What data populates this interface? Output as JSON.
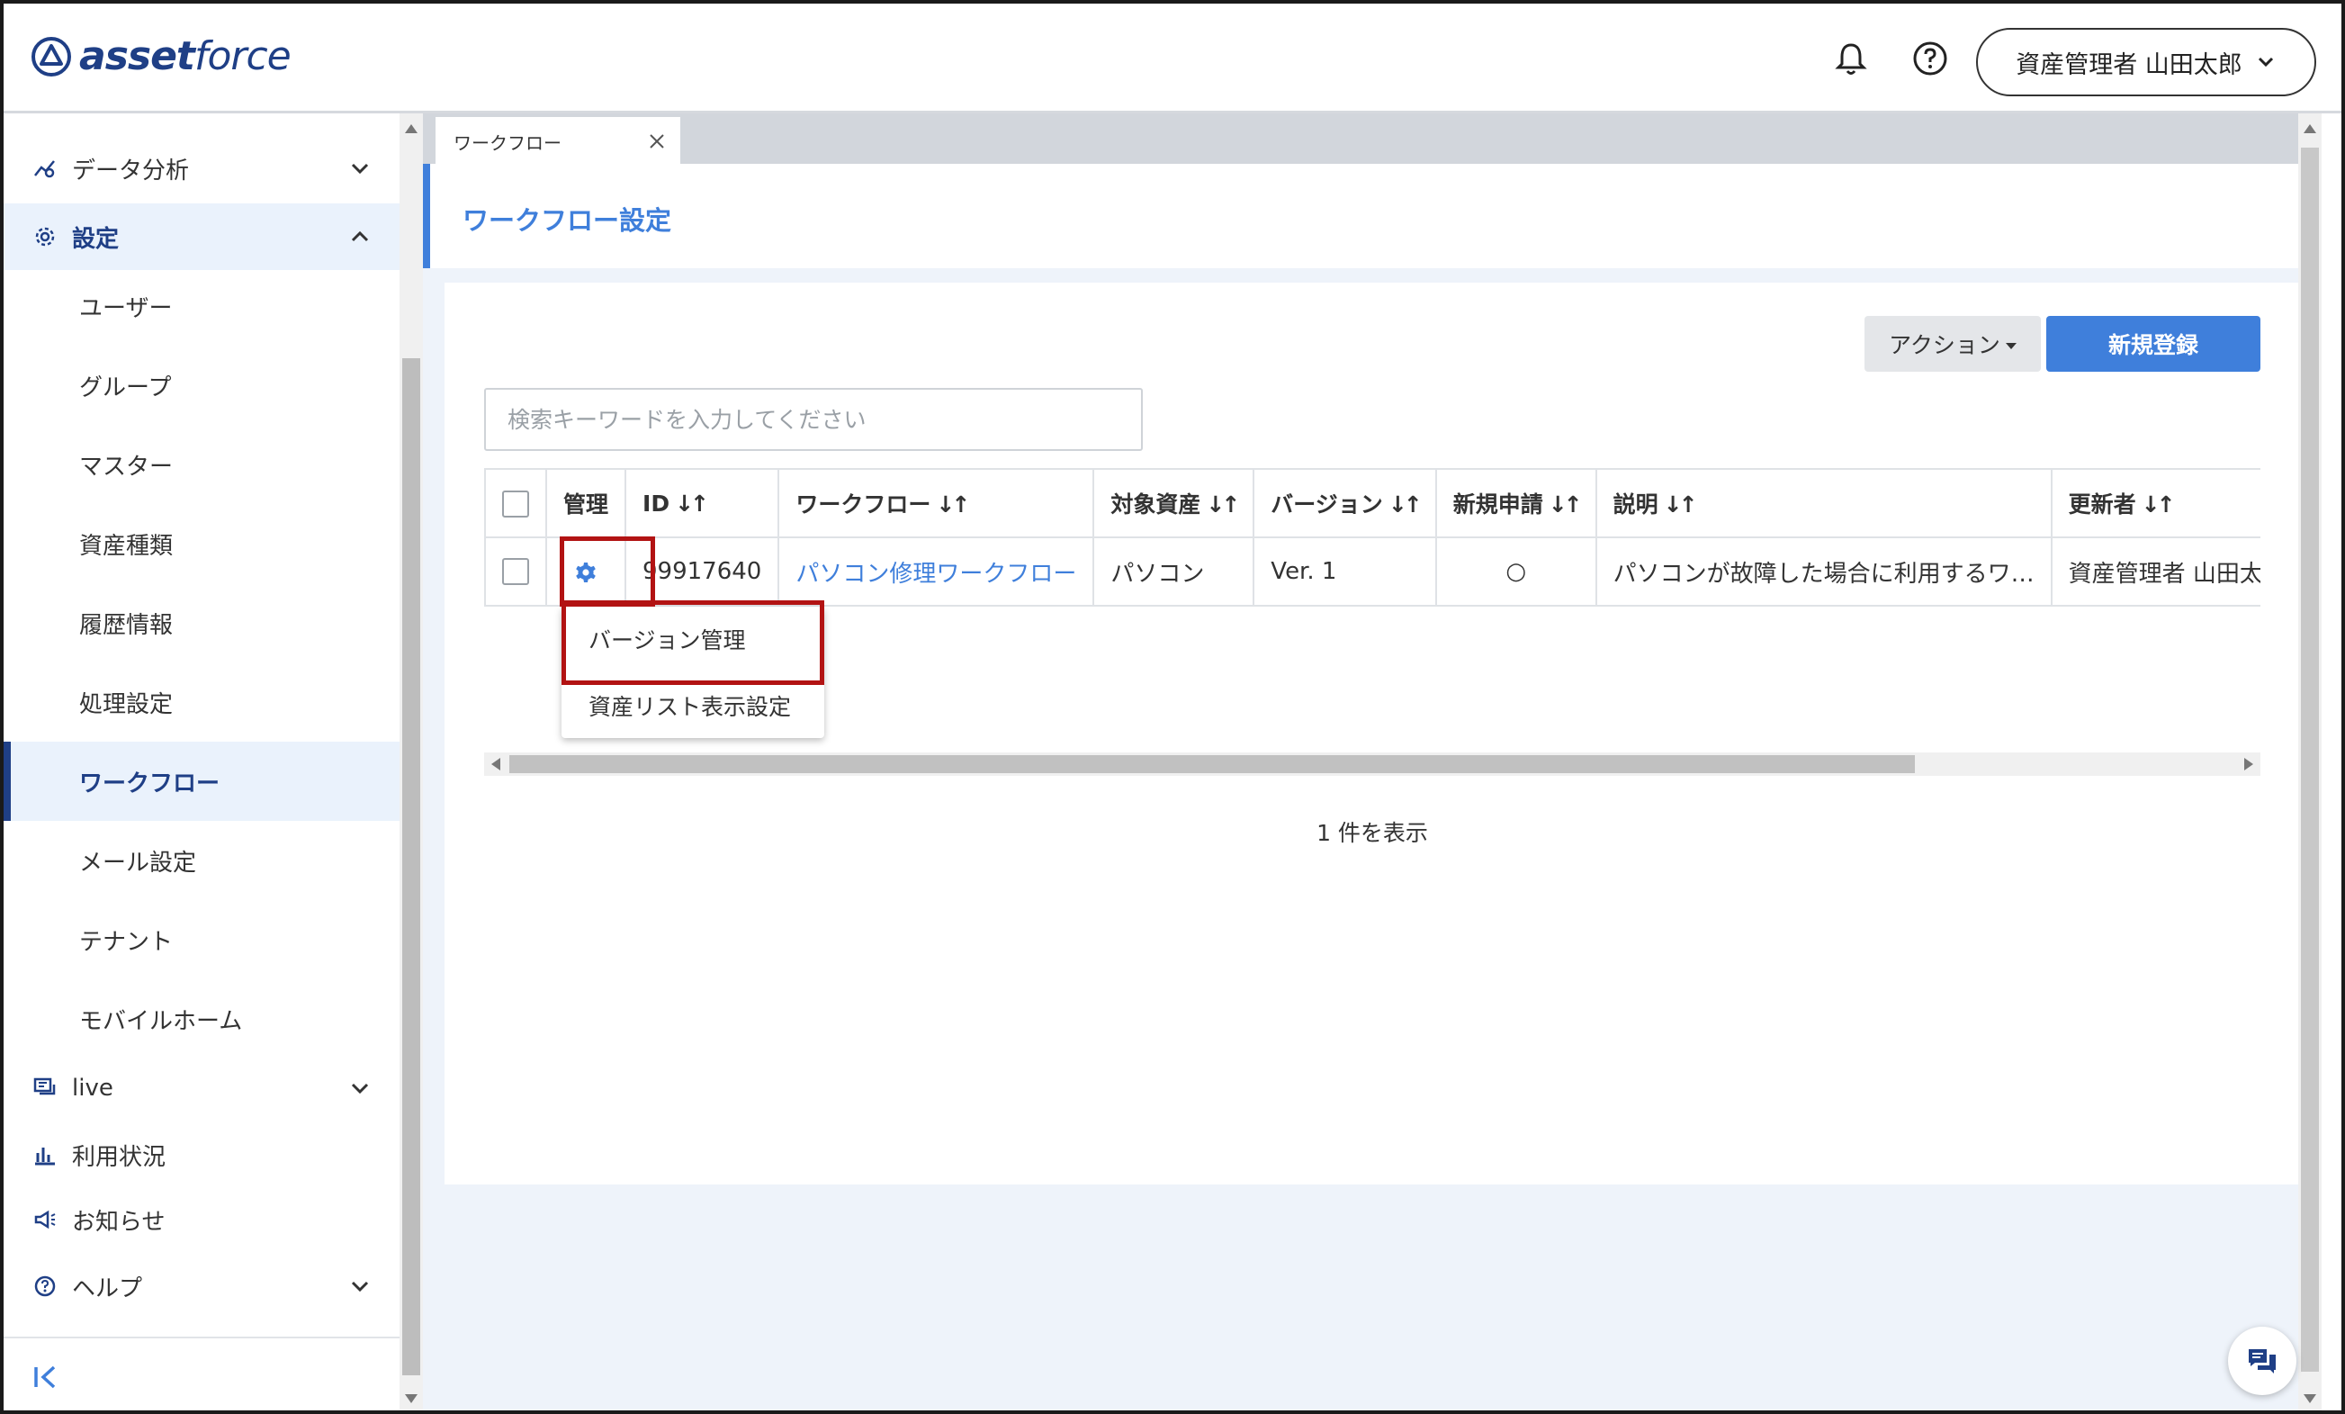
{
  "header": {
    "logo": {
      "bold": "asset",
      "light": "force"
    },
    "user_label": "資産管理者 山田太郎"
  },
  "sidebar": {
    "data_analysis": "データ分析",
    "settings": "設定",
    "settings_items": [
      "ユーザー",
      "グループ",
      "マスター",
      "資産種類",
      "履歴情報",
      "処理設定",
      "ワークフロー",
      "メール設定",
      "テナント",
      "モバイルホーム"
    ],
    "current_item": "ワークフロー",
    "live": "live",
    "usage": "利用状況",
    "news": "お知らせ",
    "help": "ヘルプ"
  },
  "tab": {
    "label": "ワークフロー"
  },
  "page": {
    "title": "ワークフロー設定"
  },
  "toolbar": {
    "action_label": "アクション",
    "new_label": "新規登録"
  },
  "search": {
    "placeholder": "検索キーワードを入力してください",
    "value": ""
  },
  "table": {
    "columns": [
      "管理",
      "ID",
      "ワークフロー",
      "対象資産",
      "バージョン",
      "新規申請",
      "説明",
      "更新者"
    ],
    "rows": [
      {
        "id": "99917640",
        "workflow": "パソコン修理ワークフロー",
        "target_asset": "パソコン",
        "version": "Ver. 1",
        "new_application": "○",
        "description": "パソコンが故障した場合に利用するワ…",
        "updater": "資産管理者 山田太"
      }
    ]
  },
  "dropdown": {
    "items": [
      "バージョン管理",
      "資産リスト表示設定"
    ]
  },
  "footer": {
    "count_text": "1 件を表示"
  },
  "colors": {
    "brand": "#1f3f86",
    "accent": "#3f7fdb",
    "highlight": "#b21313"
  }
}
